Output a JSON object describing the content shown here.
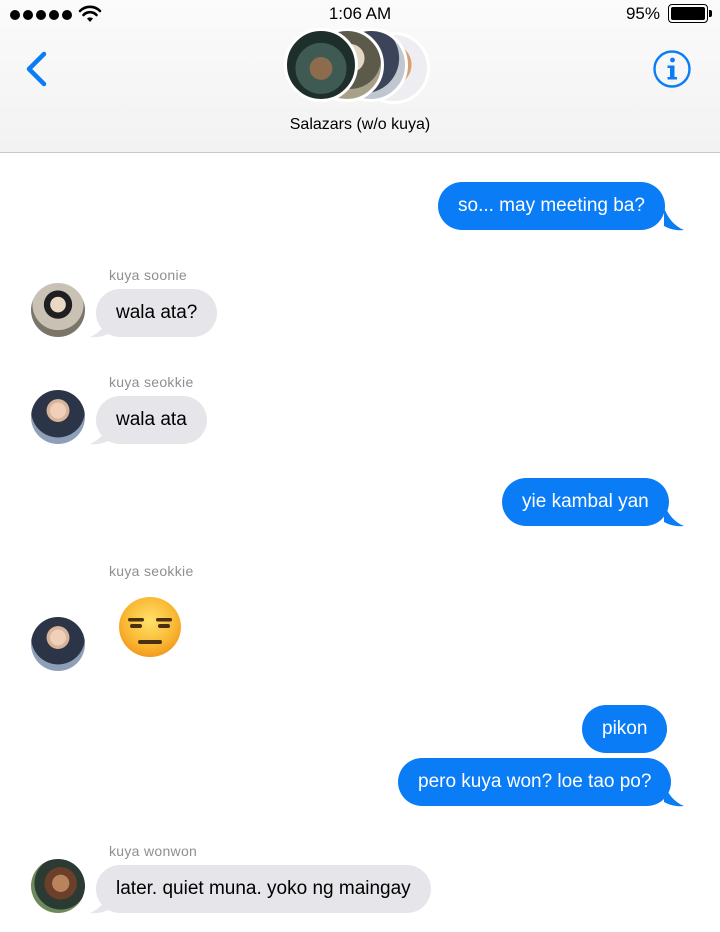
{
  "status_bar": {
    "time": "1:06 AM",
    "battery_percent": "95%",
    "signal_bars": 5
  },
  "header": {
    "back_icon": "chevron-left-icon",
    "info_icon": "info-icon",
    "group_name": "Salazars (w/o kuya)",
    "accent_color": "#0a7cf6"
  },
  "messages": [
    {
      "direction": "outgoing",
      "text": "so... may meeting ba?"
    },
    {
      "direction": "incoming",
      "sender": "kuya soonie",
      "text": "wala ata?"
    },
    {
      "direction": "incoming",
      "sender": "kuya seokkie",
      "text": "wala ata"
    },
    {
      "direction": "outgoing",
      "text": "yie kambal yan"
    },
    {
      "direction": "incoming",
      "sender": "kuya seokkie",
      "emoji": "expressionless-face"
    },
    {
      "direction": "outgoing",
      "text": "pikon"
    },
    {
      "direction": "outgoing",
      "text": "pero kuya won? loe tao po?"
    },
    {
      "direction": "incoming",
      "sender": "kuya wonwon",
      "text": "later. quiet muna. yoko ng maingay"
    }
  ]
}
